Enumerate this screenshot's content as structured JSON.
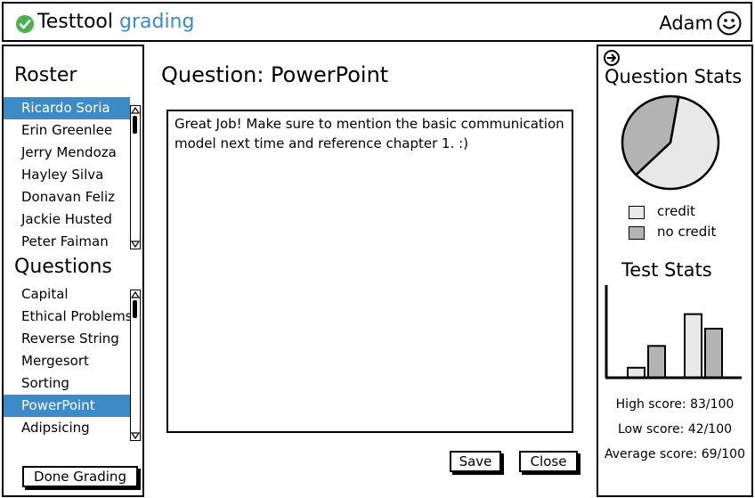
{
  "header": {
    "app_name": "Testtool",
    "app_subtitle": "grading",
    "user_name": "Adam",
    "logo_icon": "check-circle-icon",
    "avatar_icon": "smiley-face-icon",
    "accent_color": "#3c8bc6"
  },
  "roster": {
    "title": "Roster",
    "students": [
      "Ricardo Soria",
      "Erin Greenlee",
      "Jerry Mendoza",
      "Hayley Silva",
      "Donavan Feliz",
      "Jackie Husted",
      "Peter Faiman"
    ],
    "selected_index": 0
  },
  "questions": {
    "title": "Questions",
    "items": [
      "Capital",
      "Ethical Problems",
      "Reverse String",
      "Mergesort",
      "Sorting",
      "PowerPoint",
      "Adipsicing"
    ],
    "selected_index": 5
  },
  "actions": {
    "done_label": "Done Grading",
    "save_label": "Save",
    "close_label": "Close"
  },
  "main": {
    "question_title": "Question: PowerPoint",
    "comment": "Great Job! Make sure to mention the basic communication model next time and reference chapter 1. :)"
  },
  "stats": {
    "question_stats_title": "Question Stats",
    "legend": [
      {
        "label": "credit",
        "color": "#e8e8e8"
      },
      {
        "label": "no credit",
        "color": "#b3b3b3"
      }
    ],
    "test_stats_title": "Test Stats",
    "high_score": "High score: 83/100",
    "low_score": "Low score: 42/100",
    "average_score": "Average score: 69/100"
  },
  "chart_data": [
    {
      "type": "pie",
      "title": "",
      "labels": [
        "credit",
        "no credit"
      ],
      "values": [
        60,
        40
      ],
      "colors": [
        "#e8e8e8",
        "#b3b3b3"
      ]
    },
    {
      "type": "bar",
      "title": "",
      "categories": [
        "",
        "",
        "",
        ""
      ],
      "values": [
        11,
        35,
        70,
        54
      ],
      "colors": [
        "#e8e8e8",
        "#b3b3b3",
        "#e8e8e8",
        "#b3b3b3"
      ],
      "ylim": [
        0,
        100
      ],
      "grid": false
    }
  ]
}
